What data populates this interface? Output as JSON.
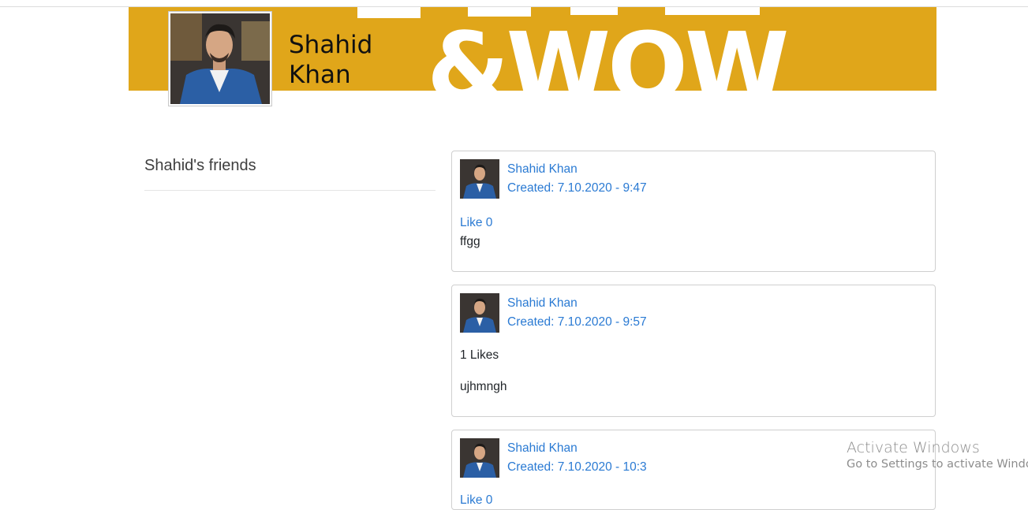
{
  "profile": {
    "name": "Shahid Khan",
    "cover_text": "&WOW",
    "cover_color": "#e0a61a"
  },
  "friends": {
    "title": "Shahid's friends"
  },
  "posts": [
    {
      "author": "Shahid Khan",
      "created": "Created: 7.10.2020 - 9:47",
      "likes": "Like 0",
      "likes_is_link": true,
      "content": "ffgg"
    },
    {
      "author": "Shahid Khan",
      "created": "Created: 7.10.2020 - 9:57",
      "likes": "1 Likes",
      "likes_is_link": false,
      "content": "ujhmngh"
    },
    {
      "author": "Shahid Khan",
      "created": "Created: 7.10.2020 - 10:3",
      "likes": "Like 0",
      "likes_is_link": true,
      "content": ""
    }
  ],
  "watermark": {
    "line1": "Activate Windows",
    "line2": "Go to Settings to activate Windows."
  },
  "colors": {
    "link": "#2a7ad3",
    "border": "#cfcfcf"
  }
}
